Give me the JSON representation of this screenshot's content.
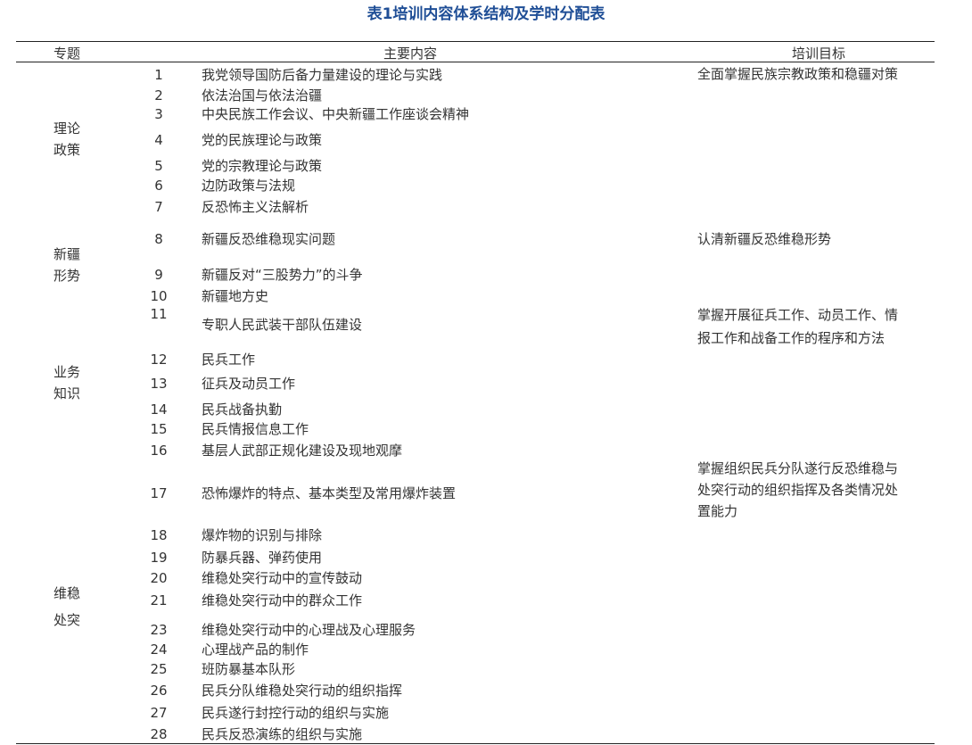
{
  "title": "表1培训内容体系结构及学时分配表",
  "headers": [
    "专题",
    "主要内容",
    "培训目标"
  ],
  "topics": [
    [
      "理论",
      "政策"
    ],
    [
      "新疆",
      "形势"
    ],
    [
      "业务",
      "知识"
    ],
    [
      "维稳",
      "处突"
    ]
  ],
  "rows": [
    {
      "num": "1",
      "content": "我党领导国防后备力量建设的理论与实践"
    },
    {
      "num": "2",
      "content": "依法治国与依法治疆"
    },
    {
      "num": "3",
      "content": "中央民族工作会议、中央新疆工作座谈会精神"
    },
    {
      "num": "4",
      "content": "党的民族理论与政策"
    },
    {
      "num": "5",
      "content": "党的宗教理论与政策"
    },
    {
      "num": "6",
      "content": "边防政策与法规"
    },
    {
      "num": "7",
      "content": "反恐怖主义法解析"
    },
    {
      "num": "8",
      "content": "新疆反恐维稳现实问题"
    },
    {
      "num": "9",
      "content": "新疆反对“三股势力”的斗争"
    },
    {
      "num": "10",
      "content": "新疆地方史"
    },
    {
      "num": "11",
      "content": "专职人民武装干部队伍建设"
    },
    {
      "num": "12",
      "content": "民兵工作"
    },
    {
      "num": "13",
      "content": "征兵及动员工作"
    },
    {
      "num": "14",
      "content": "民兵战备执勤"
    },
    {
      "num": "15",
      "content": "民兵情报信息工作"
    },
    {
      "num": "16",
      "content": "基层人武部正规化建设及现地观摩"
    },
    {
      "num": "17",
      "content": "恐怖爆炸的特点、基本类型及常用爆炸装置"
    },
    {
      "num": "18",
      "content": "爆炸物的识别与排除"
    },
    {
      "num": "19",
      "content": "防暴兵器、弹药使用"
    },
    {
      "num": "20",
      "content": "维稳处突行动中的宣传鼓动"
    },
    {
      "num": "21",
      "content": "维稳处突行动中的群众工作"
    },
    {
      "num": "23",
      "content": "维稳处突行动中的心理战及心理服务"
    },
    {
      "num": "24",
      "content": "心理战产品的制作"
    },
    {
      "num": "25",
      "content": "班防暴基本队形"
    },
    {
      "num": "26",
      "content": "民兵分队维稳处突行动的组织指挥"
    },
    {
      "num": "27",
      "content": "民兵遂行封控行动的组织与实施"
    },
    {
      "num": "28",
      "content": "民兵反恐演练的组织与实施"
    }
  ],
  "targets": [
    [
      "全面掌握民族宗教政策和稳疆对策"
    ],
    [
      "认清新疆反恐维稳形势"
    ],
    [
      "掌握开展征兵工作、动员工作、情",
      "报工作和战备工作的程序和方法"
    ],
    [
      "掌握组织民兵分队遂行反恐维稳与",
      "处突行动的组织指挥及各类情况处",
      "置能力"
    ]
  ],
  "colors": {
    "title": "#1f4e96",
    "text": "#333333",
    "rule": "#222222"
  }
}
